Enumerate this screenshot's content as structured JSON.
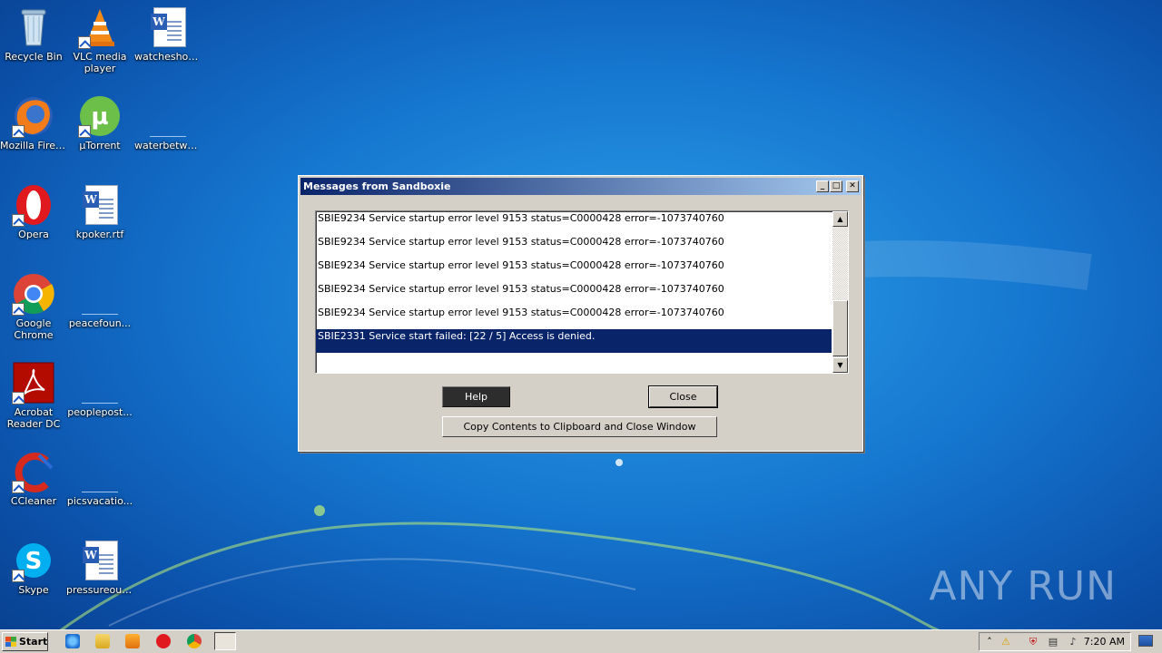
{
  "desktop": {
    "icons": [
      {
        "label": "Recycle Bin",
        "kind": "recycle-bin"
      },
      {
        "label": "VLC media player",
        "kind": "vlc"
      },
      {
        "label": "watcheshou...",
        "kind": "word-doc"
      },
      {
        "label": "Mozilla Firefox",
        "kind": "firefox"
      },
      {
        "label": "µTorrent",
        "kind": "utorrent"
      },
      {
        "label": "waterbetwe...",
        "kind": "blank-file"
      },
      {
        "label": "Opera",
        "kind": "opera"
      },
      {
        "label": "kpoker.rtf",
        "kind": "word-doc"
      },
      {
        "label": "Google Chrome",
        "kind": "chrome"
      },
      {
        "label": "peacefoun...",
        "kind": "blank-file"
      },
      {
        "label": "Acrobat Reader DC",
        "kind": "acrobat"
      },
      {
        "label": "peoplepost...",
        "kind": "blank-file"
      },
      {
        "label": "CCleaner",
        "kind": "ccleaner"
      },
      {
        "label": "picsvacatio...",
        "kind": "blank-file"
      },
      {
        "label": "Skype",
        "kind": "skype"
      },
      {
        "label": "pressureout...",
        "kind": "word-doc"
      }
    ]
  },
  "dialog": {
    "title": "Messages from Sandboxie",
    "title_buttons": [
      "minimize",
      "maximize",
      "close"
    ],
    "messages": [
      "SBIE9234 Service startup error level 9153 status=C0000428 error=-1073740760",
      "SBIE9234 Service startup error level 9153 status=C0000428 error=-1073740760",
      "SBIE9234 Service startup error level 9153 status=C0000428 error=-1073740760",
      "SBIE9234 Service startup error level 9153 status=C0000428 error=-1073740760",
      "SBIE9234 Service startup error level 9153 status=C0000428 error=-1073740760",
      "SBIE2331 Service start failed:  [22 / 5] Access is denied."
    ],
    "selected_message_index": 5,
    "buttons": {
      "help": "Help",
      "close": "Close",
      "copy": "Copy Contents to Clipboard and Close Window"
    }
  },
  "taskbar": {
    "start_label": "Start",
    "quick_launch": [
      "ie-icon",
      "explorer-icon",
      "media-player-icon",
      "opera-icon",
      "chrome-icon",
      "sandboxie-icon"
    ],
    "tray_icons": [
      "show-hidden-icon",
      "warning-icon",
      "security-icon",
      "network-icon",
      "volume-icon"
    ],
    "clock": "7:20 AM"
  },
  "watermark": "ANY RUN",
  "colors": {
    "titlebar_start": "#0a246a",
    "titlebar_end": "#a6caf0",
    "selection": "#0a246a",
    "dialog_face": "#d4d0c8"
  }
}
